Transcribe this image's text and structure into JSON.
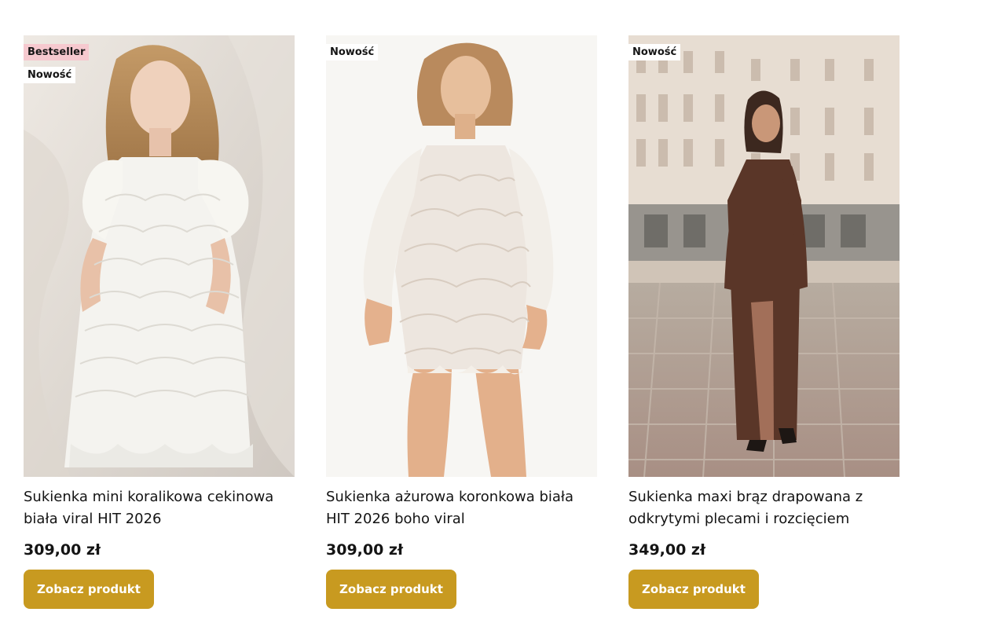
{
  "products": [
    {
      "badges": [
        "Bestseller",
        "Nowość"
      ],
      "title": "Sukienka mini koralikowa cekinowa biała viral HIT 2026",
      "price": "309,00 zł",
      "button_label": "Zobacz produkt"
    },
    {
      "badges": [
        "Nowość"
      ],
      "title": "Sukienka ażurowa koronkowa biała HIT 2026 boho viral",
      "price": "309,00 zł",
      "button_label": "Zobacz produkt"
    },
    {
      "badges": [
        "Nowość"
      ],
      "title": "Sukienka maxi brąz drapowana z odkrytymi plecami i rozcięciem",
      "price": "349,00 zł",
      "button_label": "Zobacz produkt"
    }
  ],
  "colors": {
    "button": "#c89a20",
    "bestseller_badge": "#f6c9cf",
    "text": "#141414"
  }
}
